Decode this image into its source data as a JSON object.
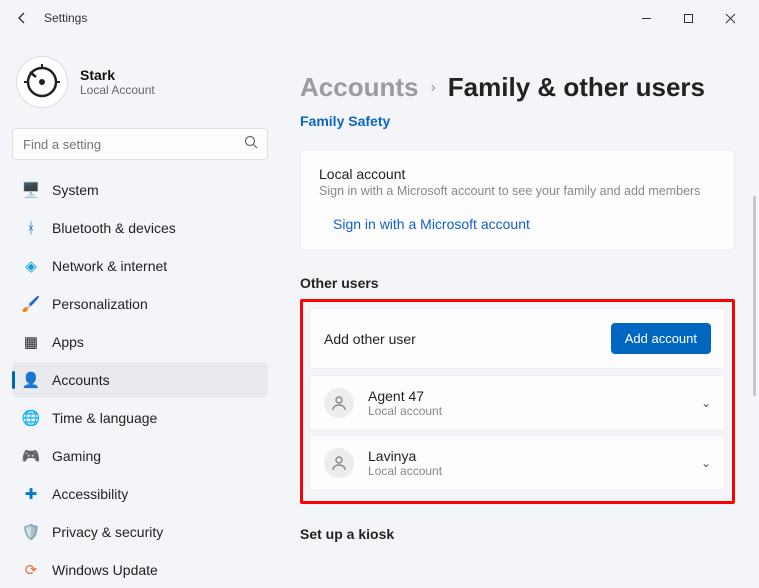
{
  "titlebar": {
    "title": "Settings"
  },
  "profile": {
    "name": "Stark",
    "type": "Local Account"
  },
  "search": {
    "placeholder": "Find a setting"
  },
  "nav": {
    "system": "System",
    "bluetooth": "Bluetooth & devices",
    "network": "Network & internet",
    "personalization": "Personalization",
    "apps": "Apps",
    "accounts": "Accounts",
    "time": "Time & language",
    "gaming": "Gaming",
    "accessibility": "Accessibility",
    "privacy": "Privacy & security",
    "update": "Windows Update"
  },
  "breadcrumb": {
    "parent": "Accounts",
    "current": "Family & other users"
  },
  "familySafety": "Family Safety",
  "localCard": {
    "title": "Local account",
    "desc": "Sign in with a Microsoft account to see your family and add members",
    "link": "Sign in with a Microsoft account"
  },
  "otherUsersLabel": "Other users",
  "addUser": {
    "label": "Add other user",
    "button": "Add account"
  },
  "users": [
    {
      "name": "Agent 47",
      "type": "Local account"
    },
    {
      "name": "Lavinya",
      "type": "Local account"
    }
  ],
  "kioskLabel": "Set up a kiosk"
}
